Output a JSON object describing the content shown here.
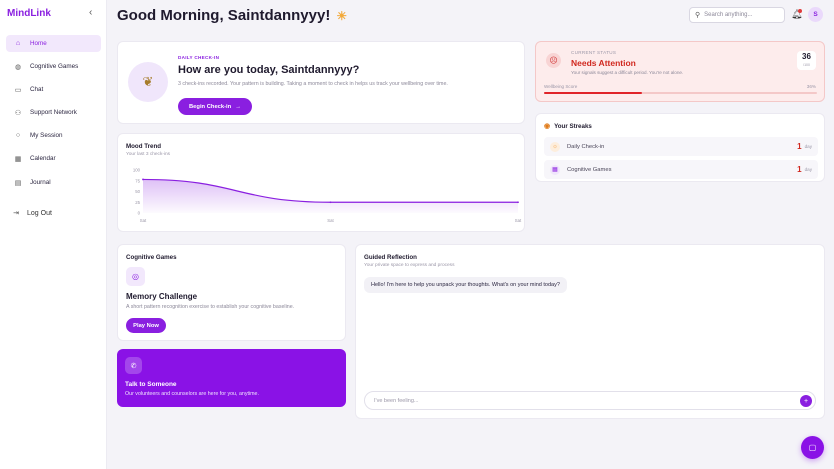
{
  "app": {
    "name": "MindLink"
  },
  "sidebar": {
    "items": [
      {
        "label": "Home",
        "icon": "home-icon",
        "active": true
      },
      {
        "label": "Cognitive Games",
        "icon": "brain-icon",
        "active": false
      },
      {
        "label": "Chat",
        "icon": "chat-icon",
        "active": false
      },
      {
        "label": "Support Network",
        "icon": "users-icon",
        "active": false
      },
      {
        "label": "My Session",
        "icon": "session-icon",
        "active": false
      },
      {
        "label": "Calendar",
        "icon": "calendar-icon",
        "active": false
      },
      {
        "label": "Journal",
        "icon": "journal-icon",
        "active": false
      }
    ],
    "logout_label": "Log Out"
  },
  "header": {
    "greeting": "Good Morning, Saintdannyyy!",
    "search_placeholder": "Search anything...",
    "avatar_initial": "S"
  },
  "checkin": {
    "eyebrow": "DAILY CHECK-IN",
    "question": "How are you today, Saintdannyyy?",
    "description": "3 check-ins recorded. Your pattern is building. Taking a moment to check in helps us track your wellbeing over time.",
    "button_label": "Begin Check-in"
  },
  "status": {
    "eyebrow": "CURRENT STATUS",
    "title": "Needs Attention",
    "description": "Your signals suggest a difficult period. You're not alone.",
    "score": "36",
    "score_label": "/100",
    "wellbeing_label": "Wellbeing Score",
    "wellbeing_pct": "36%",
    "wellbeing_value": 0.36,
    "accent": "#d0281f"
  },
  "mood": {
    "title": "Mood Trend",
    "subtitle": "Your last 3 check-ins"
  },
  "chart_data": {
    "type": "area",
    "x": [
      "Sat",
      "Sat",
      "Sat"
    ],
    "y_ticks": [
      "100",
      "75",
      "50",
      "25",
      "0"
    ],
    "series": [
      {
        "values": [
          78,
          25,
          25
        ]
      }
    ],
    "ylim": [
      0,
      100
    ],
    "color": "#8a1fe0"
  },
  "streaks": {
    "title": "Your Streaks",
    "items": [
      {
        "label": "Daily Check-in",
        "count": "1",
        "unit": "day",
        "icon": "sun-icon",
        "color": "#f4a24a"
      },
      {
        "label": "Cognitive Games",
        "count": "1",
        "unit": "day",
        "icon": "grid-icon",
        "color": "#8a1fe0"
      }
    ]
  },
  "games": {
    "title": "Cognitive Games",
    "challenge_title": "Memory Challenge",
    "challenge_desc": "A short pattern recognition exercise to establish your cognitive baseline.",
    "button_label": "Play Now"
  },
  "talk": {
    "title": "Talk to Someone",
    "description": "Our volunteers and counselors are here for you, anytime."
  },
  "reflection": {
    "title": "Guided Reflection",
    "subtitle": "Your private space to express and process",
    "message": "Hello! I'm here to help you unpack your thoughts. What's on your mind today?",
    "input_placeholder": "I've been feeling..."
  }
}
